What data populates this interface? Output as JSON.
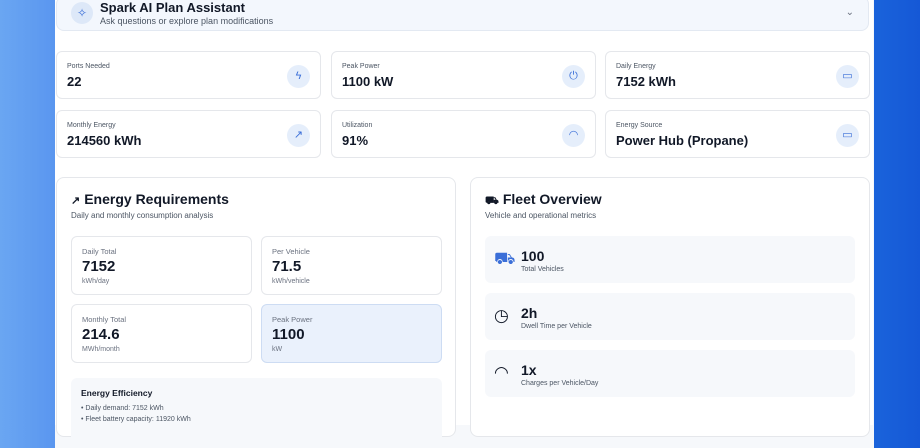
{
  "assistant": {
    "title": "Spark AI Plan Assistant",
    "subtitle": "Ask questions or explore plan modifications"
  },
  "stats": [
    {
      "label": "Ports Needed",
      "value": "22",
      "icon": "lightning-icon"
    },
    {
      "label": "Peak Power",
      "value": "1100 kW",
      "icon": "power-icon"
    },
    {
      "label": "Daily Energy",
      "value": "7152 kWh",
      "icon": "calendar-icon"
    },
    {
      "label": "Monthly Energy",
      "value": "214560 kWh",
      "icon": "trending-up-icon"
    },
    {
      "label": "Utilization",
      "value": "91%",
      "icon": "gauge-icon"
    },
    {
      "label": "Energy Source",
      "value": "Power Hub (Propane)",
      "icon": "battery-icon"
    }
  ],
  "energy": {
    "title": "Energy Requirements",
    "subtitle": "Daily and monthly consumption analysis",
    "boxes": [
      {
        "label": "Daily Total",
        "value": "7152",
        "unit": "kWh/day"
      },
      {
        "label": "Per Vehicle",
        "value": "71.5",
        "unit": "kWh/vehicle"
      },
      {
        "label": "Monthly Total",
        "value": "214.6",
        "unit": "MWh/month"
      },
      {
        "label": "Peak Power",
        "value": "1100",
        "unit": "kW"
      }
    ],
    "efficiency": {
      "title": "Energy Efficiency",
      "items": [
        "• Daily demand: 7152 kWh",
        "• Fleet battery capacity: 11920 kWh"
      ]
    }
  },
  "fleet": {
    "title": "Fleet Overview",
    "subtitle": "Vehicle and operational metrics",
    "rows": [
      {
        "value": "100",
        "label": "Total Vehicles",
        "icon": "truck-icon"
      },
      {
        "value": "2h",
        "label": "Dwell Time per Vehicle",
        "icon": "clock-icon"
      },
      {
        "value": "1x",
        "label": "Charges per Vehicle/Day",
        "icon": "gauge-icon"
      }
    ]
  }
}
